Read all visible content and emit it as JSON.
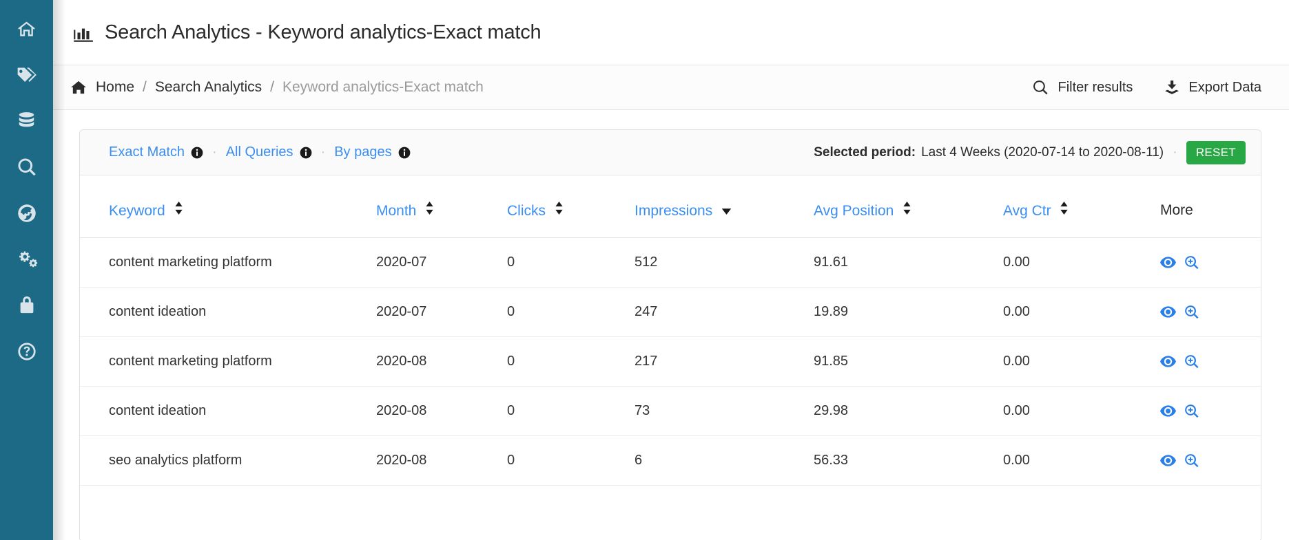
{
  "sidebar": {
    "items": [
      {
        "name": "home-icon",
        "label": "Home"
      },
      {
        "name": "tags-icon",
        "label": "Tags"
      },
      {
        "name": "database-icon",
        "label": "Database"
      },
      {
        "name": "search-icon",
        "label": "Search"
      },
      {
        "name": "globe-icon",
        "label": "Globe"
      },
      {
        "name": "cogs-icon",
        "label": "Settings"
      },
      {
        "name": "lock-icon",
        "label": "Security"
      },
      {
        "name": "help-circle-icon",
        "label": "Help"
      }
    ]
  },
  "header": {
    "icon": "chart-bar-icon",
    "title": "Search Analytics - Keyword analytics-Exact match"
  },
  "breadcrumb": {
    "home_icon": "home-solid-icon",
    "items": [
      {
        "label": "Home",
        "muted": false
      },
      {
        "label": "Search Analytics",
        "muted": false
      },
      {
        "label": "Keyword analytics-Exact match",
        "muted": true
      }
    ],
    "separator": "/",
    "actions": [
      {
        "icon": "search-icon",
        "label": "Filter results"
      },
      {
        "icon": "download-icon",
        "label": "Export Data"
      }
    ]
  },
  "card": {
    "tabs": [
      {
        "label": "Exact Match",
        "info_icon": "info-circle-icon"
      },
      {
        "label": "All Queries",
        "info_icon": "info-circle-icon"
      },
      {
        "label": "By pages",
        "info_icon": "info-circle-icon"
      }
    ],
    "tab_separator": "·",
    "period": {
      "label": "Selected period:",
      "value": "Last 4 Weeks (2020-07-14 to 2020-08-11)",
      "separator": "·",
      "reset_label": "RESET",
      "reset_color": "#28a745"
    }
  },
  "table": {
    "columns": [
      {
        "label": "Keyword",
        "sortable": true,
        "sort": "none",
        "link": true
      },
      {
        "label": "Month",
        "sortable": true,
        "sort": "none",
        "link": true
      },
      {
        "label": "Clicks",
        "sortable": true,
        "sort": "none",
        "link": true
      },
      {
        "label": "Impressions",
        "sortable": true,
        "sort": "desc",
        "link": true
      },
      {
        "label": "Avg Position",
        "sortable": true,
        "sort": "none",
        "link": true
      },
      {
        "label": "Avg Ctr",
        "sortable": true,
        "sort": "none",
        "link": true
      },
      {
        "label": "More",
        "sortable": false,
        "sort": "none",
        "link": false
      }
    ],
    "rows": [
      {
        "keyword": "content marketing platform",
        "month": "2020-07",
        "clicks": "0",
        "impressions": "512",
        "avg_position": "91.61",
        "avg_ctr": "0.00"
      },
      {
        "keyword": "content ideation",
        "month": "2020-07",
        "clicks": "0",
        "impressions": "247",
        "avg_position": "19.89",
        "avg_ctr": "0.00"
      },
      {
        "keyword": "content marketing platform",
        "month": "2020-08",
        "clicks": "0",
        "impressions": "217",
        "avg_position": "91.85",
        "avg_ctr": "0.00"
      },
      {
        "keyword": "content ideation",
        "month": "2020-08",
        "clicks": "0",
        "impressions": "73",
        "avg_position": "29.98",
        "avg_ctr": "0.00"
      },
      {
        "keyword": "seo analytics platform",
        "month": "2020-08",
        "clicks": "0",
        "impressions": "6",
        "avg_position": "56.33",
        "avg_ctr": "0.00"
      }
    ],
    "row_actions": [
      {
        "icon": "eye-icon",
        "label": "View"
      },
      {
        "icon": "search-plus-icon",
        "label": "Zoom in"
      }
    ]
  },
  "colors": {
    "sidebar": "#1d6a87",
    "link": "#3b8ef0",
    "accent_green": "#28a745"
  }
}
